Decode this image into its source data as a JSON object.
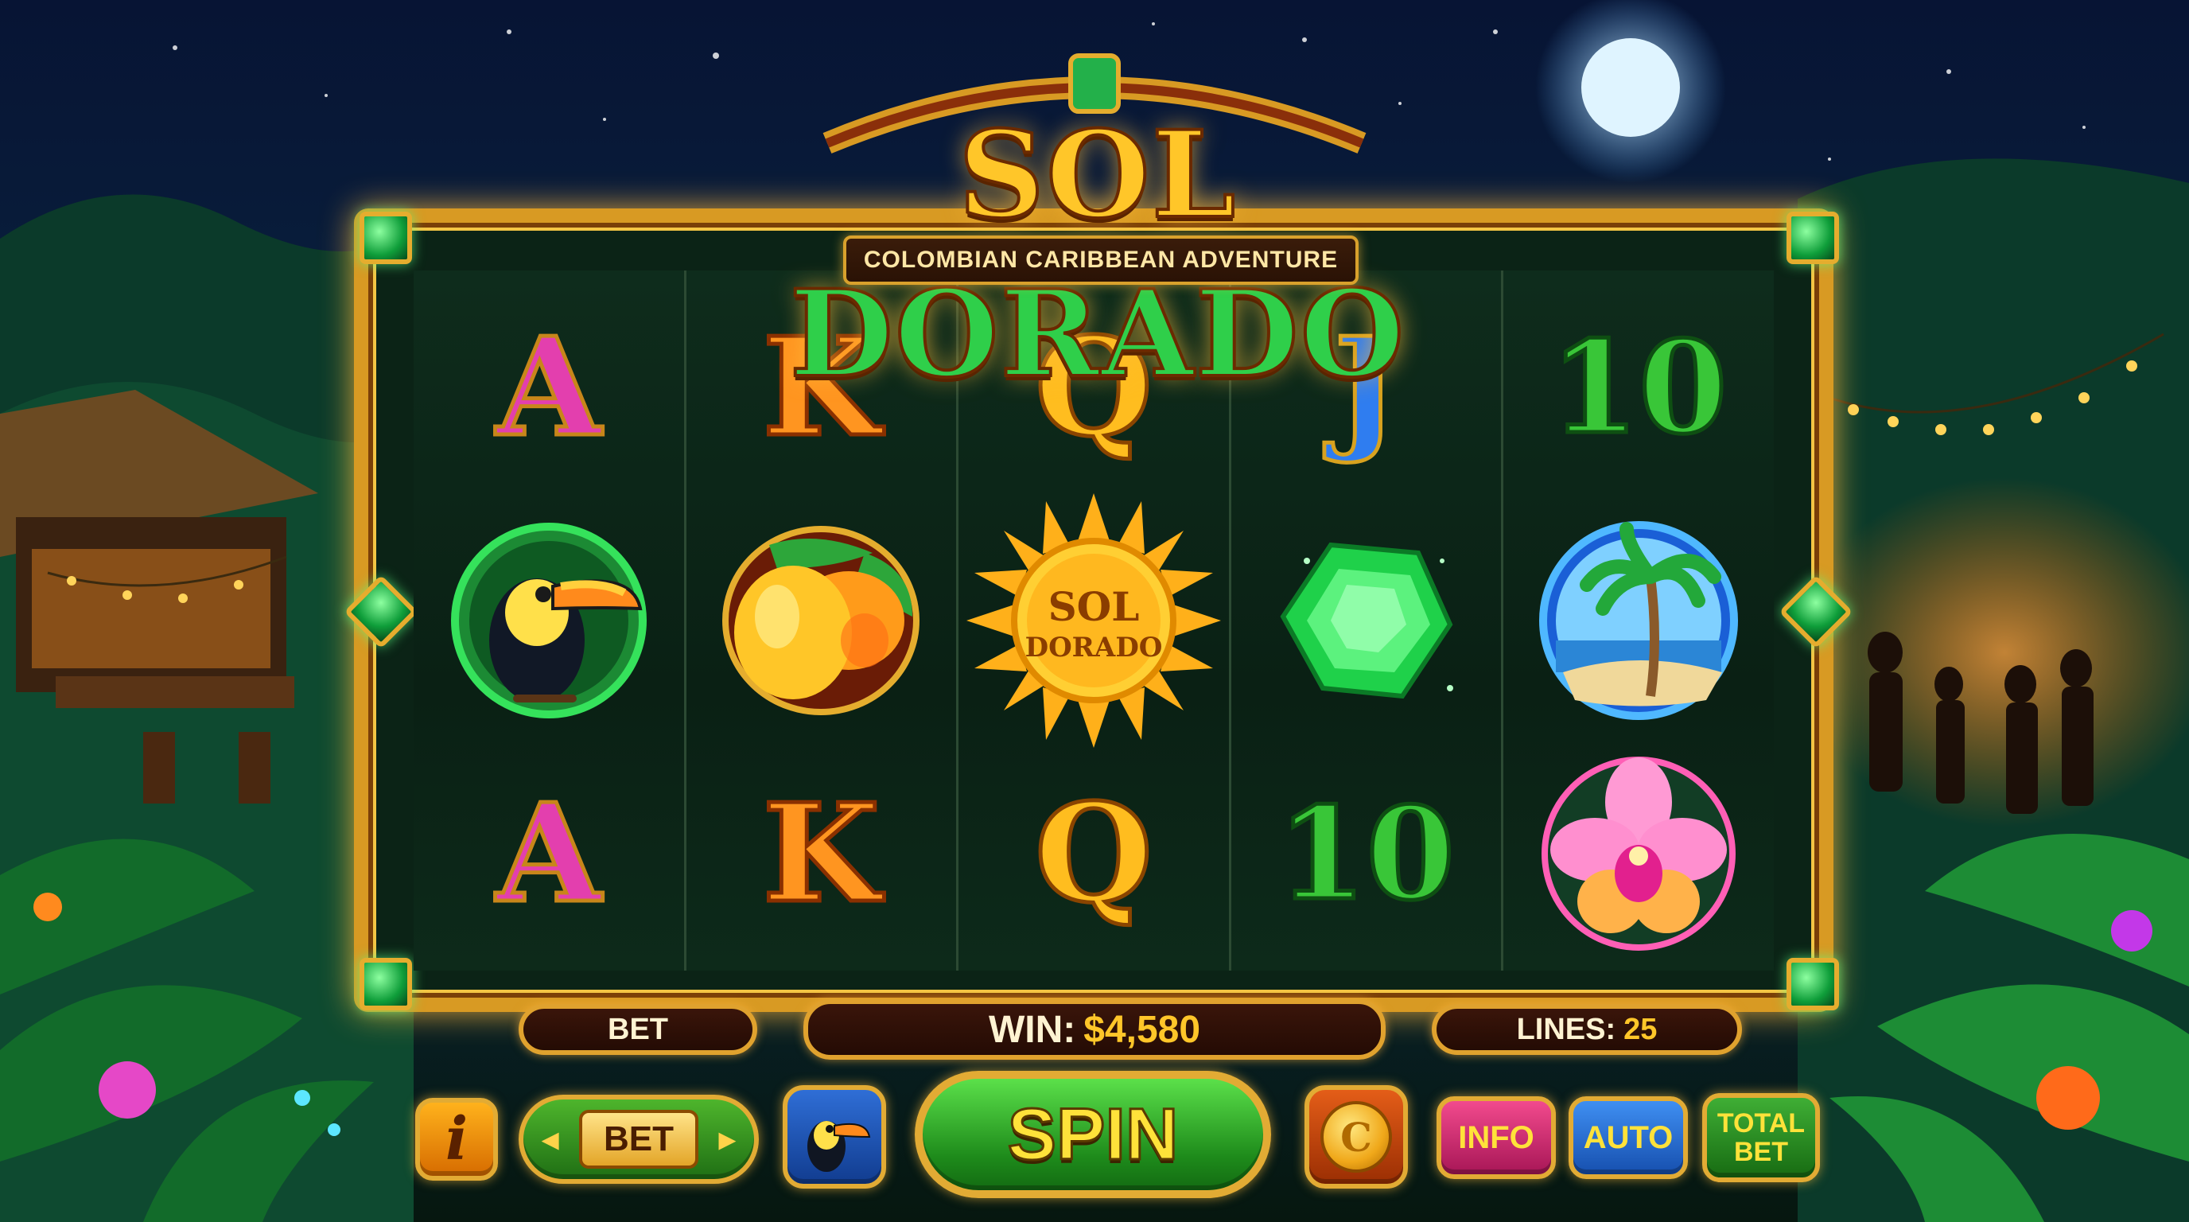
{
  "game": {
    "title_word1": "SOL",
    "title_word2": "DORADO",
    "subtitle": "COLOMBIAN CARIBBEAN ADVENTURE"
  },
  "reels": [
    [
      {
        "type": "card",
        "text": "A",
        "color": "pink"
      },
      {
        "type": "icon",
        "icon": "toucan-icon"
      },
      {
        "type": "card",
        "text": "A",
        "color": "pink"
      }
    ],
    [
      {
        "type": "card",
        "text": "K",
        "color": "orange"
      },
      {
        "type": "icon",
        "icon": "mango-icon"
      },
      {
        "type": "card",
        "text": "K",
        "color": "orange"
      }
    ],
    [
      {
        "type": "card",
        "text": "Q",
        "color": "gold"
      },
      {
        "type": "wild",
        "line1": "SOL",
        "line2": "DORADO"
      },
      {
        "type": "card",
        "text": "Q",
        "color": "gold"
      }
    ],
    [
      {
        "type": "card",
        "text": "J",
        "color": "blue"
      },
      {
        "type": "icon",
        "icon": "emerald-icon"
      },
      {
        "type": "card",
        "text": "10",
        "color": "green"
      }
    ],
    [
      {
        "type": "card",
        "text": "10",
        "color": "green"
      },
      {
        "type": "icon",
        "icon": "palm-beach-icon"
      },
      {
        "type": "icon",
        "icon": "orchid-icon"
      }
    ]
  ],
  "status": {
    "bet_label": "BET",
    "win_label": "WIN:",
    "win_value": "$4,580",
    "lines_label": "LINES:",
    "lines_value": "25"
  },
  "controls": {
    "info_i": "i",
    "bet_left": "◂",
    "bet_label": "BET",
    "bet_right": "▸",
    "spin": "SPIN",
    "coin_symbol": "C",
    "info": "INFO",
    "auto": "AUTO",
    "total_line1": "TOTAL",
    "total_line2": "BET"
  },
  "colors": {
    "gold": "#ffc629",
    "green": "#2fcf4a",
    "frame": "#d89a23",
    "night_sky": "#06122b"
  }
}
